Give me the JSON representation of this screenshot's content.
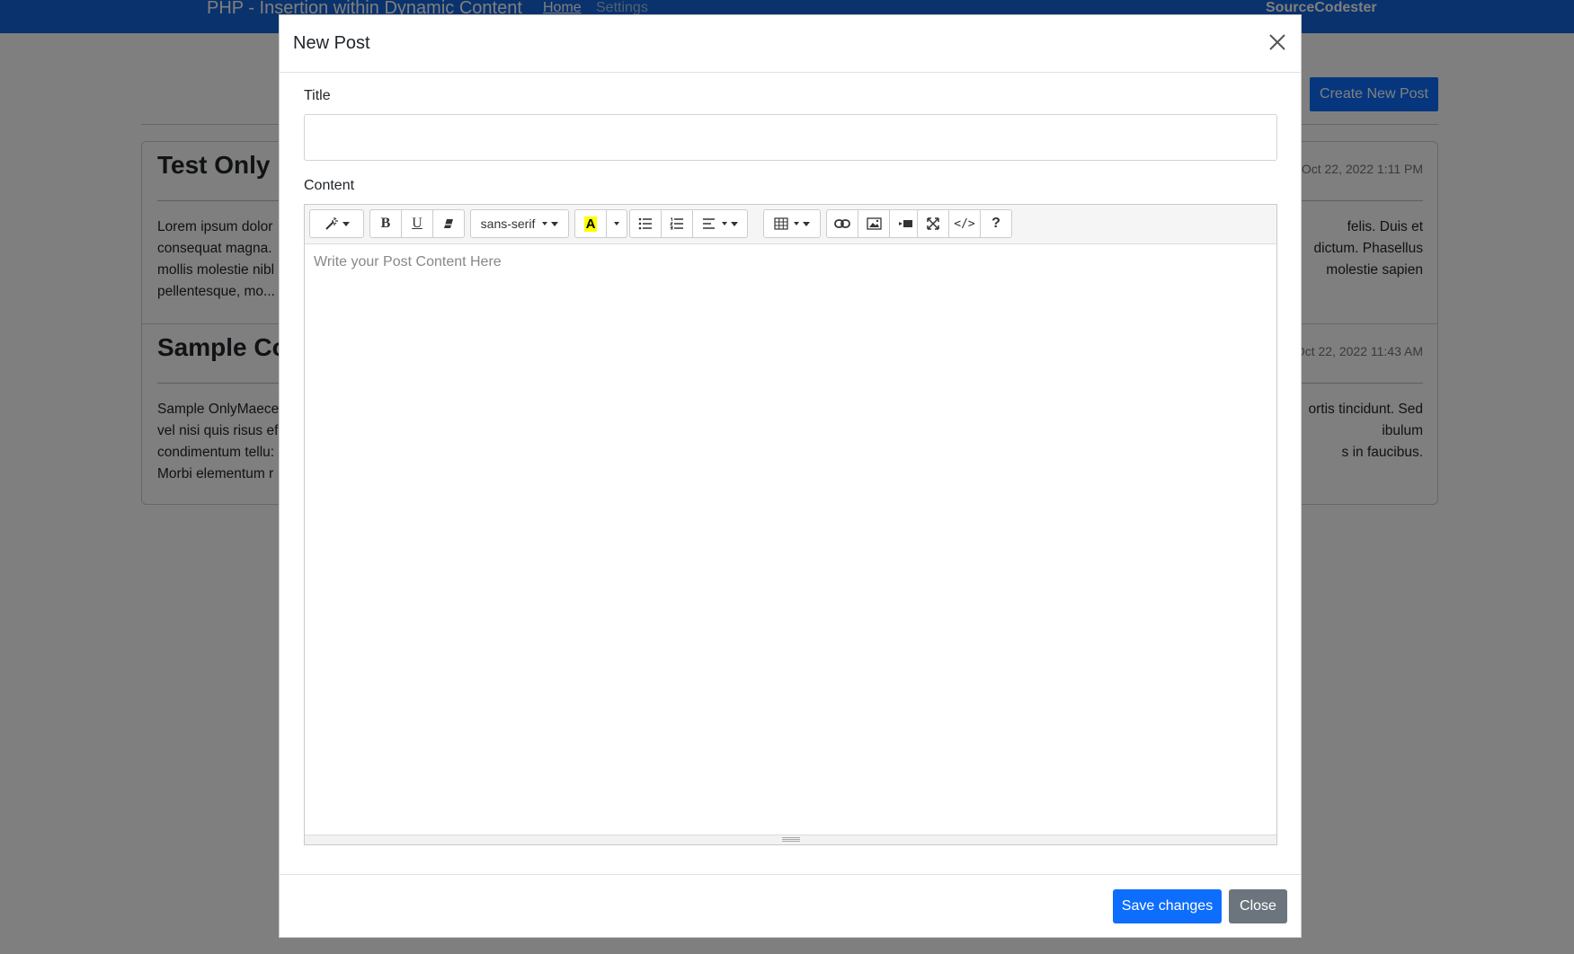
{
  "navbar": {
    "title": "PHP - Insertion within Dynamic Content",
    "links": [
      "Home",
      "Settings"
    ],
    "brand": "SourceCodester"
  },
  "page": {
    "create_button": "Create New Post",
    "posts": [
      {
        "title": "Test Only",
        "date": "Oct 22, 2022 1:11 PM",
        "lines_left": [
          "Lorem ipsum dolor",
          "consequat magna.",
          "mollis molestie nibl",
          "pellentesque, mo..."
        ],
        "lines_right": [
          "felis. Duis et",
          "dictum. Phasellus",
          "molestie sapien",
          ""
        ]
      },
      {
        "title": "Sample Co",
        "date": "Oct 22, 2022 11:43 AM",
        "lines_left": [
          "Sample OnlyMaece",
          "vel nisi quis risus ef",
          "condimentum tellu:",
          "Morbi elementum r"
        ],
        "lines_right": [
          "ortis tincidunt. Sed",
          "ibulum",
          "s in faucibus.",
          ""
        ]
      }
    ]
  },
  "modal": {
    "title": "New Post",
    "title_label": "Title",
    "title_value": "",
    "content_label": "Content",
    "content_placeholder": "Write your Post Content Here",
    "toolbar": {
      "font_name": "sans-serif",
      "bold": "B",
      "underline": "U",
      "code_view": "</>",
      "help": "?",
      "highlight_color": "#ffff00"
    },
    "save_button": "Save changes",
    "close_button": "Close"
  }
}
